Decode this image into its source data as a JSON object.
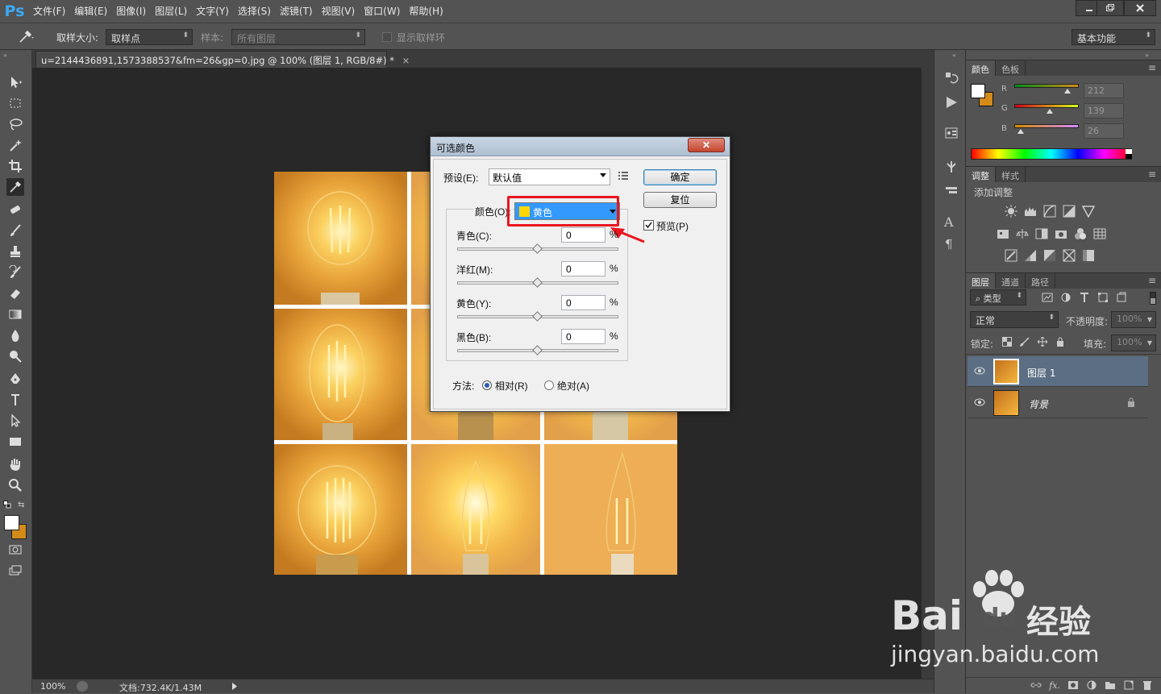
{
  "app": {
    "logo": "Ps",
    "menu": [
      "文件(F)",
      "编辑(E)",
      "图像(I)",
      "图层(L)",
      "文字(Y)",
      "选择(S)",
      "滤镜(T)",
      "视图(V)",
      "窗口(W)",
      "帮助(H)"
    ],
    "window_controls": [
      "minimize-icon",
      "restore-icon",
      "close-icon"
    ]
  },
  "options": {
    "sample_size_label": "取样大小:",
    "sample_size_value": "取样点",
    "sample_label": "样本:",
    "sample_value": "所有图层",
    "show_ring_label": "显示取样环",
    "workspace": "基本功能"
  },
  "document": {
    "tab_title": "u=2144436891,1573388537&fm=26&gp=0.jpg @ 100% (图层 1, RGB/8#) *",
    "tab_close": "×"
  },
  "status": {
    "zoom": "100%",
    "doc_info": "文档:732.4K/1.43M"
  },
  "color_panel": {
    "tabs": [
      "颜色",
      "色板"
    ],
    "channels": [
      {
        "label": "R",
        "value": "212",
        "level": 0.83
      },
      {
        "label": "G",
        "value": "139",
        "level": 0.55
      },
      {
        "label": "B",
        "value": "26",
        "level": 0.1
      }
    ],
    "fg_color": "#ffffff",
    "bg_color": "#d48b1a"
  },
  "adjust_panel": {
    "tabs": [
      "调整",
      "样式"
    ],
    "title": "添加调整"
  },
  "layers_panel": {
    "tabs": [
      "图层",
      "通道",
      "路径"
    ],
    "filter_label": "类型",
    "blend_mode": "正常",
    "opacity_label": "不透明度:",
    "opacity_value": "100%",
    "lock_label": "锁定:",
    "fill_label": "填充:",
    "fill_value": "100%",
    "layers": [
      {
        "name": "图层 1",
        "selected": true,
        "locked": false
      },
      {
        "name": "背景",
        "selected": false,
        "locked": true
      }
    ]
  },
  "dialog": {
    "title": "可选颜色",
    "close": "✕",
    "preset_label": "预设(E):",
    "preset_value": "默认值",
    "ok": "确定",
    "reset": "复位",
    "preview_label": "预览(P)",
    "preview_checked": true,
    "colors_label": "颜色(O):",
    "colors_value": "黄色",
    "colors_swatch": "#ffd700",
    "sliders": [
      {
        "label": "青色(C):",
        "value": "0",
        "unit": "%"
      },
      {
        "label": "洋红(M):",
        "value": "0",
        "unit": "%"
      },
      {
        "label": "黄色(Y):",
        "value": "0",
        "unit": "%"
      },
      {
        "label": "黑色(B):",
        "value": "0",
        "unit": "%"
      }
    ],
    "method_label": "方法:",
    "method_relative": "相对(R)",
    "method_absolute": "绝对(A)",
    "method_selected": "relative"
  },
  "watermark": {
    "brand": "Bai",
    "brand_du": "du",
    "brand_cn": "经验",
    "url": "jingyan.baidu.com"
  }
}
